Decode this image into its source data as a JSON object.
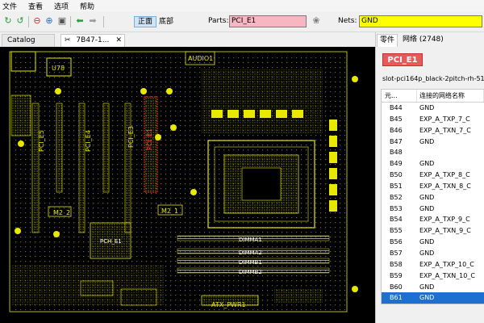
{
  "menu": [
    "文件",
    "查看",
    "选项",
    "帮助"
  ],
  "toolbar": {
    "side_front": "正面",
    "side_bottom": "底部",
    "parts_label": "Parts:",
    "parts_value": "PCI_E1",
    "nets_label": "Nets:",
    "nets_value": "GND"
  },
  "tabs": [
    {
      "label": "Catalog",
      "active": false
    },
    {
      "label": "7B47-1...",
      "active": true
    }
  ],
  "board_labels": {
    "u78": "U78",
    "audio1": "AUDIO1",
    "pci_e5": "PCI_E5",
    "pci_e4": "PCI_E4",
    "pci_e3": "PCI_E3",
    "pci_e1": "PCI_E1",
    "m2_2": "M2_2",
    "m2_1": "M2_1",
    "pch": "PCH_E1",
    "dimma1": "DIMMA1",
    "dimma2": "DIMMA2",
    "dimmb1": "DIMMB1",
    "dimmb2": "DIMMB2",
    "atx_pwr1": "ATX_PWR1"
  },
  "right_panel": {
    "tab_parts": "零件",
    "tab_nets": "网络 (2748)",
    "part_name": "PCI_E1",
    "footprint": "slot-pci164p_black-2pitch-rh-51",
    "col_pin": "元...",
    "col_net": "连接的网络名称",
    "pins": [
      {
        "pin": "B44",
        "net": "GND"
      },
      {
        "pin": "B45",
        "net": "EXP_A_TXP_7_C"
      },
      {
        "pin": "B46",
        "net": "EXP_A_TXN_7_C"
      },
      {
        "pin": "B47",
        "net": "GND"
      },
      {
        "pin": "B48",
        "net": ""
      },
      {
        "pin": "B49",
        "net": "GND"
      },
      {
        "pin": "B50",
        "net": "EXP_A_TXP_8_C"
      },
      {
        "pin": "B51",
        "net": "EXP_A_TXN_8_C"
      },
      {
        "pin": "B52",
        "net": "GND"
      },
      {
        "pin": "B53",
        "net": "GND"
      },
      {
        "pin": "B54",
        "net": "EXP_A_TXP_9_C"
      },
      {
        "pin": "B55",
        "net": "EXP_A_TXN_9_C"
      },
      {
        "pin": "B56",
        "net": "GND"
      },
      {
        "pin": "B57",
        "net": "GND"
      },
      {
        "pin": "B58",
        "net": "EXP_A_TXP_10_C"
      },
      {
        "pin": "B59",
        "net": "EXP_A_TXN_10_C"
      },
      {
        "pin": "B60",
        "net": "GND"
      },
      {
        "pin": "B61",
        "net": "GND"
      }
    ],
    "selected_index": 17
  },
  "colors": {
    "board_bg": "#000000",
    "silkscreen": "#e8e800",
    "highlight": "#ff3030",
    "parts_bg": "#f7b6c2",
    "nets_bg": "#ffff00",
    "selection": "#1e6fd0"
  }
}
